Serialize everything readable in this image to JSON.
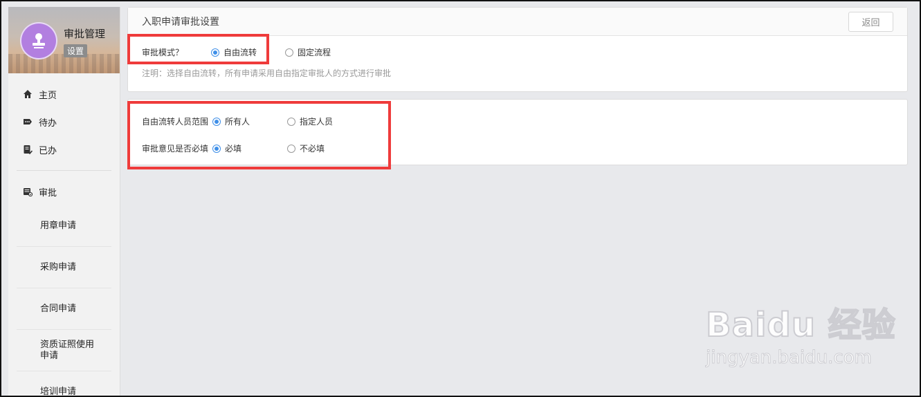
{
  "sidebar": {
    "title": "审批管理",
    "badge": "设置",
    "nav": [
      {
        "label": "主页",
        "icon": "home-icon"
      },
      {
        "label": "待办",
        "icon": "tag-icon"
      },
      {
        "label": "已办",
        "icon": "done-icon"
      }
    ],
    "approval": {
      "label": "审批",
      "icon": "approval-icon"
    },
    "sub_items": [
      "用章申请",
      "采购申请",
      "合同申请",
      "资质证照使用申请",
      "培训申请"
    ]
  },
  "header": {
    "title": "入职申请审批设置",
    "back_label": "返回"
  },
  "mode": {
    "label": "审批模式？",
    "options": [
      "自由流转",
      "固定流程"
    ],
    "selected": "自由流转",
    "note": "注明：选择自由流转，所有申请采用自由指定审批人的方式进行审批"
  },
  "scope": {
    "label": "自由流转人员范围",
    "options": [
      "所有人",
      "指定人员"
    ],
    "selected": "所有人"
  },
  "opinion": {
    "label": "审批意见是否必填",
    "options": [
      "必填",
      "不必填"
    ],
    "selected": "必填"
  },
  "watermark": {
    "logo": "Baidu 经验",
    "url": "jingyan.baidu.com"
  },
  "colors": {
    "accent": "#3f8fe8",
    "highlight": "#ef3b3b",
    "avatar": "#b27fe0"
  }
}
